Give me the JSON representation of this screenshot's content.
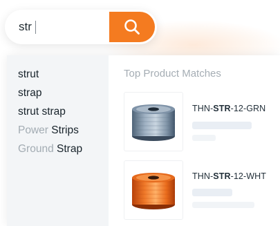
{
  "search": {
    "value": "str"
  },
  "search_button": {
    "icon": "search-icon",
    "color": "#f47b20"
  },
  "suggestions": [
    {
      "prefix": "",
      "match": "strut"
    },
    {
      "prefix": "",
      "match": "strap"
    },
    {
      "prefix": "",
      "match": "strut strap"
    },
    {
      "prefix": "Power ",
      "match": "Strips"
    },
    {
      "prefix": "Ground ",
      "match": "Strap"
    }
  ],
  "matches": {
    "title": "Top Product Matches",
    "products": [
      {
        "sku_prefix": "THN-",
        "sku_match": "STR",
        "sku_suffix": "-12-GRN",
        "image": "gray-wire-spool"
      },
      {
        "sku_prefix": "THN-",
        "sku_match": "STR",
        "sku_suffix": "-12-WHT",
        "image": "orange-wire-spool"
      }
    ]
  },
  "colors": {
    "accent": "#f47b20",
    "suggestion_panel": "#f3f5f7"
  }
}
